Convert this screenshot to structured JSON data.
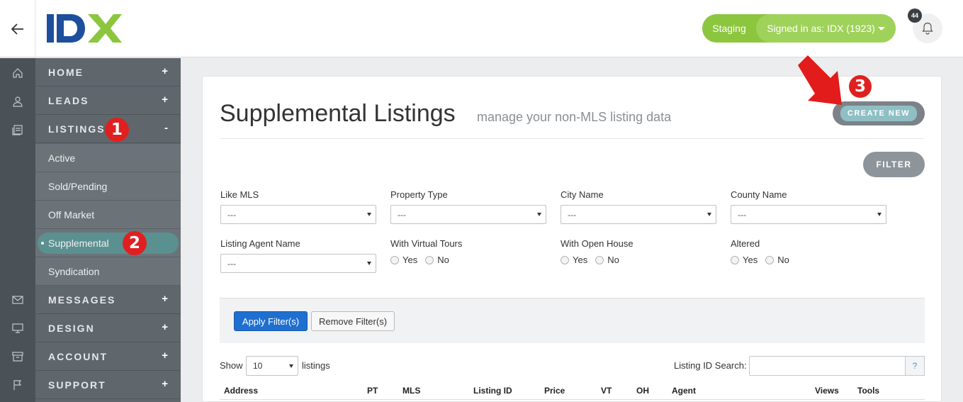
{
  "header": {
    "back_icon": "arrow-left-icon",
    "logo_text": "IDX",
    "environment": "Staging",
    "signed_in": "Signed in as: IDX (1923)",
    "notifications_count": "44",
    "bell_icon": "bell-icon"
  },
  "rail": {
    "icons": [
      "home-icon",
      "user-icon",
      "listings-icon",
      "mail-icon",
      "monitor-icon",
      "archive-icon",
      "flag-icon"
    ]
  },
  "sidebar": {
    "home": "HOME",
    "leads": "LEADS",
    "listings": "LISTINGS",
    "listings_toggle": "-",
    "expand": "+",
    "sub": {
      "active": "Active",
      "sold_pending": "Sold/Pending",
      "off_market": "Off Market",
      "supplemental": "Supplemental",
      "syndication": "Syndication"
    },
    "messages": "MESSAGES",
    "design": "DESIGN",
    "account": "ACCOUNT",
    "support": "SUPPORT"
  },
  "annotations": {
    "marker_1": "1",
    "marker_2": "2",
    "marker_3": "3",
    "arrow_color": "#e21b1b"
  },
  "main": {
    "title": "Supplemental Listings",
    "subtitle": "manage your non-MLS listing data",
    "create_label": "CREATE NEW",
    "filter_label": "FILTER",
    "filters": {
      "like_mls": {
        "label": "Like MLS",
        "value": "---"
      },
      "property_type": {
        "label": "Property Type",
        "value": "---"
      },
      "city_name": {
        "label": "City Name",
        "value": "---"
      },
      "county_name": {
        "label": "County Name",
        "value": "---"
      },
      "listing_agent": {
        "label": "Listing Agent Name",
        "value": "---"
      },
      "virtual_tours": {
        "label": "With Virtual Tours"
      },
      "open_house": {
        "label": "With Open House"
      },
      "altered": {
        "label": "Altered"
      },
      "yes": "Yes",
      "no": "No"
    },
    "apply_label": "Apply Filter(s)",
    "remove_label": "Remove Filter(s)",
    "show_label": "Show",
    "show_value": "10",
    "listings_label": "listings",
    "search_label": "Listing ID Search:",
    "search_value": "",
    "help_label": "?",
    "columns": [
      "Address",
      "PT",
      "MLS",
      "Listing ID",
      "Price",
      "VT",
      "OH",
      "Agent",
      "Views",
      "Tools"
    ]
  },
  "colors": {
    "brand_blue": "#1d4f9c",
    "brand_green": "#8cc63f",
    "sidebar": "#5f676d",
    "active_item": "#5b9091",
    "apply_button": "#1f6fd1"
  }
}
